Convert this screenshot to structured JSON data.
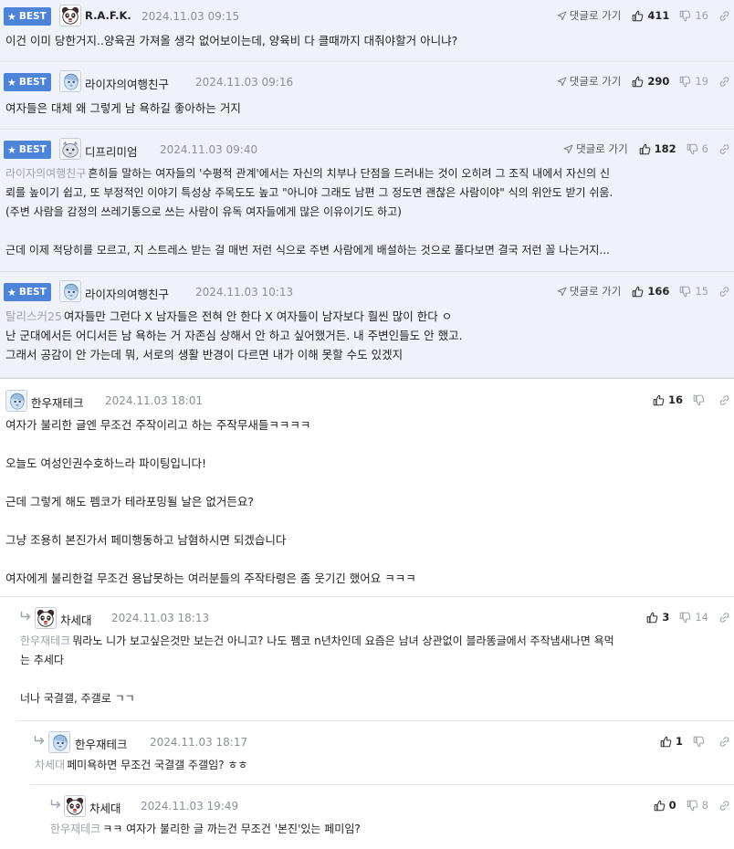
{
  "labels": {
    "best": "BEST",
    "goto_reply": "댓글로 가기"
  },
  "comments": [
    {
      "nick": "R.A.F.K.",
      "date": "2024.11.03 09:15",
      "up": "411",
      "down": "16",
      "lines": [
        "이건 이미 당한거지..양육권 가져올 생각 없어보이는데, 양육비 다 클때까지 대줘야할거 아니냐?"
      ]
    },
    {
      "nick": "라이자의여행친구",
      "date": "2024.11.03 09:16",
      "up": "290",
      "down": "19",
      "lines": [
        "여자들은 대체 왜 그렇게 남 욕하길 좋아하는 거지"
      ]
    },
    {
      "nick": "디프리미엄",
      "date": "2024.11.03 09:40",
      "up": "182",
      "down": "6",
      "mention": "라이자의여행친구",
      "lines": [
        "흔히들 말하는 여자들의 '수평적 관계'에서는 자신의 치부나 단점을 드러내는 것이 오히려 그 조직 내에서 자신의 신",
        "뢰를 높이기 쉽고, 또 부정적인 이야기 특성상 주목도도 높고 \"아니야 그래도 남편 그 정도면 괜찮은 사람이야\" 식의 위안도 받기 쉬움.",
        "(주변 사람을 감정의 쓰레기통으로 쓰는 사람이 유독 여자들에게 많은 이유이기도 하고)",
        "",
        "근데 이제 적당히를 모르고, 지 스트레스 받는 걸 매번 저런 식으로 주변 사람에게 배설하는 것으로 풀다보면 결국 저런 꼴 나는거지..."
      ]
    },
    {
      "nick": "라이자의여행친구",
      "date": "2024.11.03 10:13",
      "up": "166",
      "down": "15",
      "mention": "탈리스커25",
      "lines": [
        "여자들만 그런다 X 남자들은 전혀 안 한다 X 여자들이 남자보다 훨씬 많이 한다 ㅇ",
        "난 군대에서든 어디서든 남 욕하는 거 자존심 상해서 안 하고 싶어했거든. 내 주변인들도 안 했고.",
        "그래서 공감이 안 가는데 뭐, 서로의 생활 반경이 다르면 내가 이해 못할 수도 있겠지"
      ]
    },
    {
      "nick": "한우재테크",
      "date": "2024.11.03 18:01",
      "up": "16",
      "down": "",
      "lines": [
        "여자가 불리한 글엔 무조건 주작이리고 하는 주작무새들ㅋㅋㅋㅋ",
        "",
        "오늘도 여성인권수호하느라 파이팅입니다!",
        "",
        "근데 그렇게 해도 펨코가 테라포밍될 날은 없거든요?",
        "",
        "그냥 조용히 본진가서 페미행동하고 남혐하시면 되겠습니다",
        "",
        "여자에게 불리한걸 무조건 용납못하는 여러분들의 주작타령은 좀 웃기긴 했어요 ㅋㅋㅋ"
      ]
    },
    {
      "nick": "차세대",
      "date": "2024.11.03 18:13",
      "up": "3",
      "down": "14",
      "mention": "한우재테크",
      "lines": [
        "뭐라노 니가 보고싶은것만 보는건 아니고? 나도 펨코 n년차인데 요즘은 남녀 상관없이 블라똥글에서 주작냄새나면 욕먹",
        "는 추세다",
        "",
        "너나 국결갤, 주갤로 ㄱㄱ"
      ]
    },
    {
      "nick": "한우재테크",
      "date": "2024.11.03 18:17",
      "up": "1",
      "down": "",
      "mention": "차세대",
      "lines": [
        "페미욕하면 무조건 국결갤 주갤임? ㅎㅎ"
      ]
    },
    {
      "nick": "차세대",
      "date": "2024.11.03 19:49",
      "up": "0",
      "down": "8",
      "mention": "한우재테크",
      "lines": [
        "ㅋㅋ 여자가 불리한 글 까는건 무조건 '본진'있는 페미임?"
      ]
    }
  ]
}
